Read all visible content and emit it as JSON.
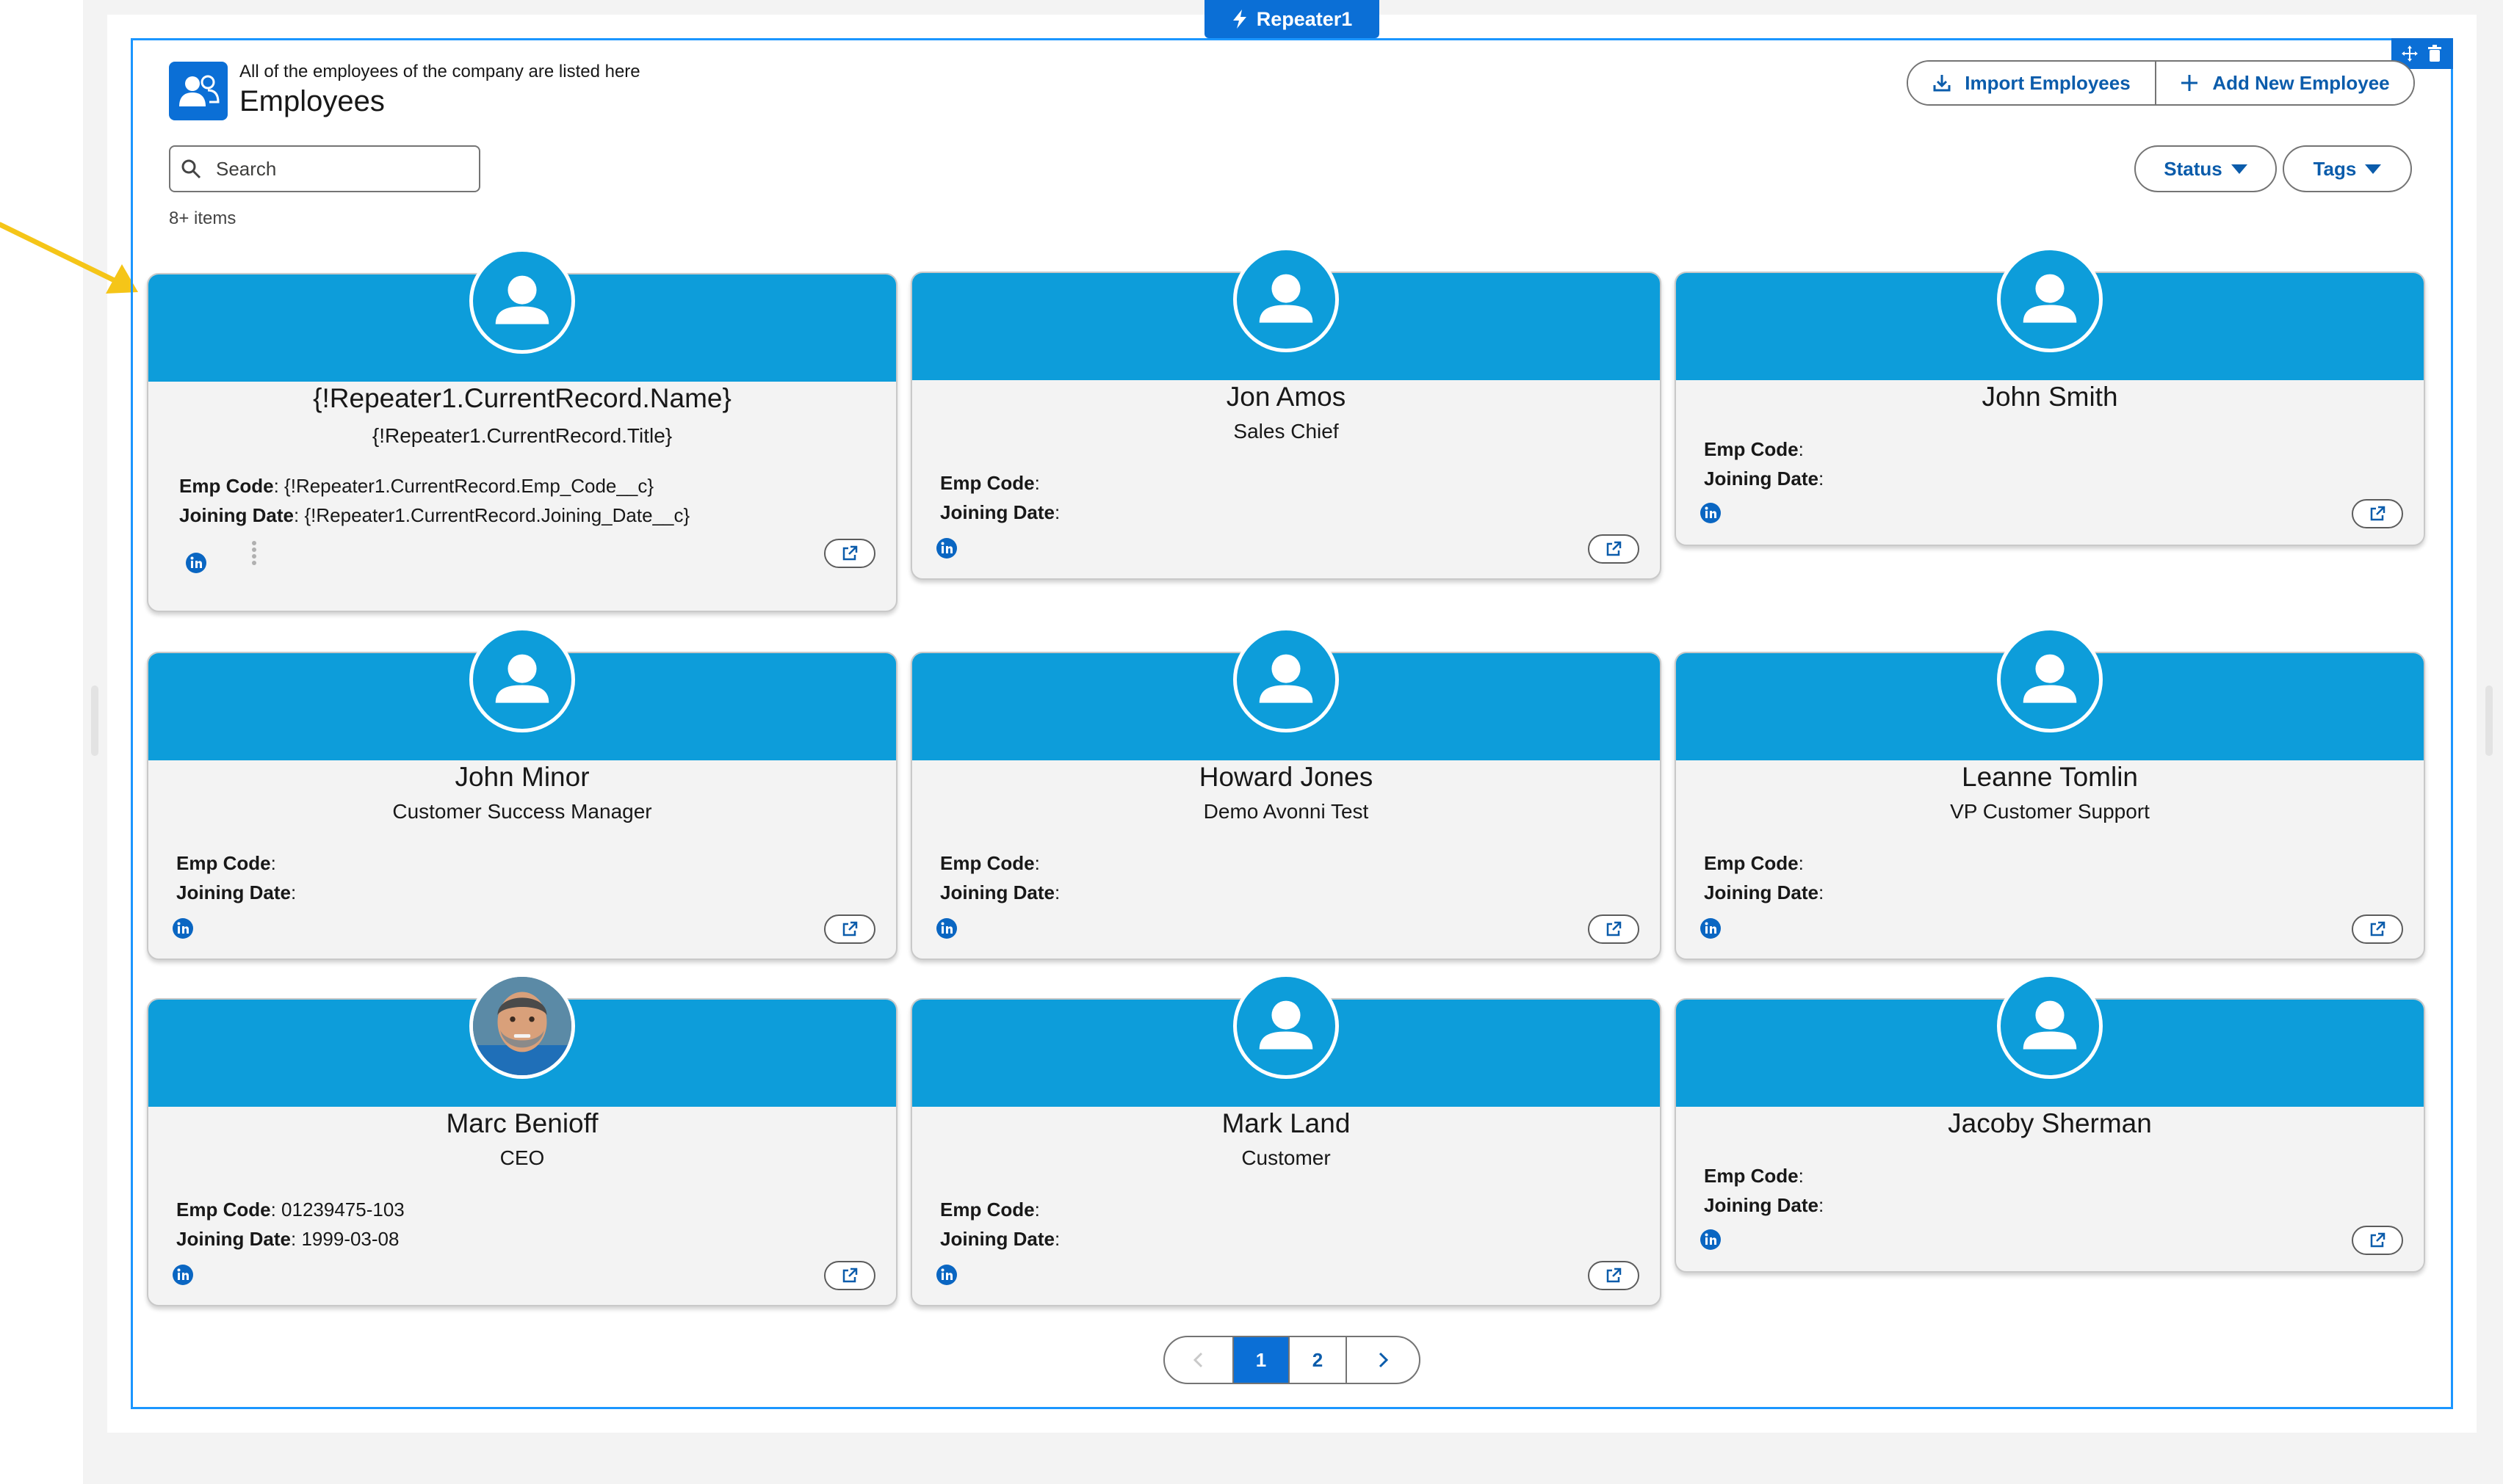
{
  "repeater": {
    "tab_label": "Repeater1"
  },
  "header": {
    "subtitle": "All of the employees of the company are listed here",
    "title": "Employees",
    "import_label": "Import Employees",
    "add_label": "Add New Employee"
  },
  "search": {
    "placeholder": "Search"
  },
  "item_count": "8+ items",
  "filters": {
    "status_label": "Status",
    "tags_label": "Tags"
  },
  "fields": {
    "emp_code_label": "Emp Code",
    "joining_date_label": "Joining Date"
  },
  "cards": [
    {
      "name": "{!Repeater1.CurrentRecord.Name}",
      "title": "{!Repeater1.CurrentRecord.Title}",
      "emp_code": " {!Repeater1.CurrentRecord.Emp_Code__c}",
      "joining_date": " {!Repeater1.CurrentRecord.Joining_Date__c}"
    },
    {
      "name": "Jon Amos",
      "title": "Sales Chief",
      "emp_code": "",
      "joining_date": ""
    },
    {
      "name": "John Smith",
      "title": "",
      "emp_code": "",
      "joining_date": ""
    },
    {
      "name": "John Minor",
      "title": "Customer Success Manager",
      "emp_code": "",
      "joining_date": ""
    },
    {
      "name": "Howard Jones",
      "title": "Demo Avonni Test",
      "emp_code": "",
      "joining_date": ""
    },
    {
      "name": "Leanne Tomlin",
      "title": "VP Customer Support",
      "emp_code": "",
      "joining_date": ""
    },
    {
      "name": "Marc Benioff",
      "title": "CEO",
      "emp_code": " 01239475-103",
      "joining_date": " 1999-03-08",
      "avatar": "photo"
    },
    {
      "name": "Mark Land",
      "title": "Customer",
      "emp_code": "",
      "joining_date": ""
    },
    {
      "name": "Jacoby Sherman",
      "title": "",
      "emp_code": "",
      "joining_date": ""
    }
  ],
  "pagination": {
    "pages": [
      "1",
      "2"
    ],
    "current": "1"
  },
  "colors": {
    "brand": "#0b6fd6",
    "banner": "#0d9dda",
    "link": "#0b5cab",
    "selection": "#1b96ff",
    "annotation_arrow": "#f5c518"
  }
}
